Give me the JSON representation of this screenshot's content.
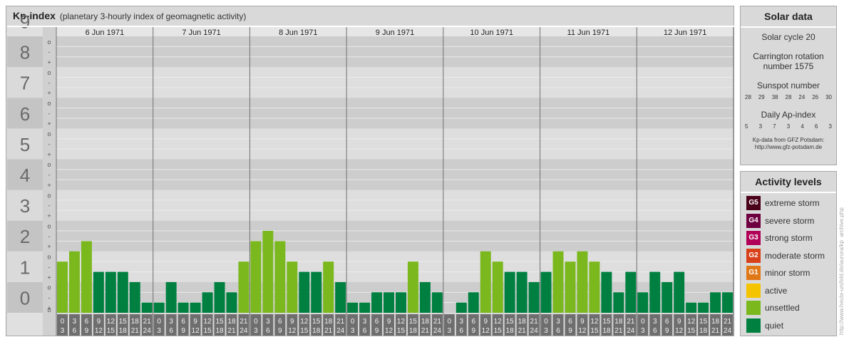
{
  "header": {
    "title": "Kp-index",
    "subtitle": "(planetary 3-hourly index of geomagnetic activity)"
  },
  "chart_data": {
    "type": "bar",
    "title": "Kp-index",
    "subtitle": "(planetary 3-hourly index of geomagnetic activity)",
    "ylim": [
      0,
      9
    ],
    "y_tick_labels": [
      "0",
      "1",
      "2",
      "3",
      "4",
      "5",
      "6",
      "7",
      "8",
      "9"
    ],
    "minor_tick_marks": [
      "+",
      "o",
      "-"
    ],
    "days": [
      "6 Jun 1971",
      "7 Jun 1971",
      "8 Jun 1971",
      "9 Jun 1971",
      "10 Jun 1971",
      "11 Jun 1971",
      "12 Jun 1971"
    ],
    "interval_labels": [
      [
        "0",
        "3"
      ],
      [
        "3",
        "6"
      ],
      [
        "6",
        "9"
      ],
      [
        "9",
        "12"
      ],
      [
        "12",
        "15"
      ],
      [
        "15",
        "18"
      ],
      [
        "18",
        "21"
      ],
      [
        "21",
        "24"
      ]
    ],
    "values": [
      [
        1.667,
        2.0,
        2.333,
        1.333,
        1.333,
        1.333,
        1.0,
        0.333
      ],
      [
        0.333,
        1.0,
        0.333,
        0.333,
        0.667,
        1.0,
        0.667,
        1.667
      ],
      [
        2.333,
        2.667,
        2.333,
        1.667,
        1.333,
        1.333,
        1.667,
        1.0
      ],
      [
        0.333,
        0.333,
        0.667,
        0.667,
        0.667,
        1.667,
        1.0,
        0.667
      ],
      [
        0.0,
        0.333,
        0.667,
        2.0,
        1.667,
        1.333,
        1.333,
        1.0
      ],
      [
        1.333,
        2.0,
        1.667,
        2.0,
        1.667,
        1.333,
        0.667,
        1.333
      ],
      [
        0.667,
        1.333,
        1.0,
        1.333,
        0.333,
        0.333,
        0.667,
        0.667
      ]
    ],
    "thresholds": {
      "unsettled": 1.667,
      "active": 3.667
    },
    "colors": {
      "quiet": "#008040",
      "unsettled": "#7ab81e",
      "active": "#f5c400"
    },
    "grid": true
  },
  "solar": {
    "heading": "Solar data",
    "cycle": "Solar cycle 20",
    "carrington_line1": "Carrington rotation",
    "carrington_line2": "number 1575",
    "sunspot_heading": "Sunspot number",
    "sunspot_numbers": [
      "28",
      "29",
      "38",
      "28",
      "24",
      "26",
      "30"
    ],
    "ap_heading": "Daily Ap-index",
    "ap_values": [
      "5",
      "3",
      "7",
      "3",
      "4",
      "6",
      "3"
    ],
    "credit_line1": "Kp-data from GFZ Potsdam:",
    "credit_line2": "http://www.gfz-potsdam.de"
  },
  "activity": {
    "heading": "Activity levels",
    "levels": [
      {
        "code": "G5",
        "label": "extreme storm",
        "color": "#4a0018"
      },
      {
        "code": "G4",
        "label": "severe storm",
        "color": "#6e0040"
      },
      {
        "code": "G3",
        "label": "strong storm",
        "color": "#b00058"
      },
      {
        "code": "G2",
        "label": "moderate storm",
        "color": "#d8401a"
      },
      {
        "code": "G1",
        "label": "minor storm",
        "color": "#e07818"
      },
      {
        "code": "",
        "label": "active",
        "color": "#f5c400"
      },
      {
        "code": "",
        "label": "unsettled",
        "color": "#7ab81e"
      },
      {
        "code": "",
        "label": "quiet",
        "color": "#008040"
      }
    ]
  },
  "watermark": "http://www.heute-ursfeld.de/aurora/kp_archive.php"
}
